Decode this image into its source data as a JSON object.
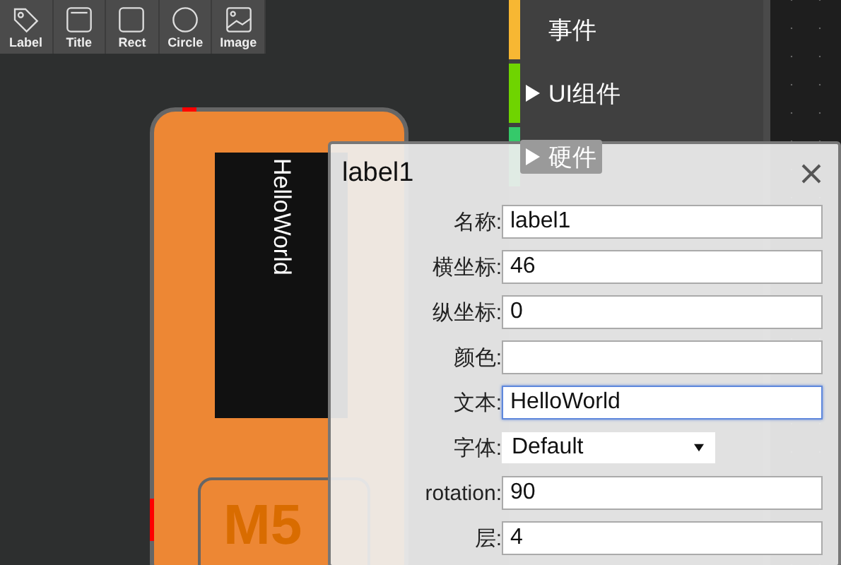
{
  "toolbar": [
    {
      "label": "Label",
      "kind": "tag"
    },
    {
      "label": "Title",
      "kind": "title"
    },
    {
      "label": "Rect",
      "kind": "rect"
    },
    {
      "label": "Circle",
      "kind": "circle"
    },
    {
      "label": "Image",
      "kind": "image"
    }
  ],
  "device": {
    "screen_text": "HelloWorld",
    "logo": "M5"
  },
  "categories": [
    {
      "label": "事件",
      "color": "#f7b733",
      "expandable": false
    },
    {
      "label": "UI组件",
      "color": "#6fd400",
      "expandable": true
    },
    {
      "label": "硬件",
      "color": "#35c96a",
      "expandable": true
    }
  ],
  "dialog": {
    "title": "label1",
    "fields": [
      {
        "label": "名称:",
        "kind": "text",
        "value": "label1",
        "focused": false
      },
      {
        "label": "横坐标:",
        "kind": "text",
        "value": "46",
        "focused": false
      },
      {
        "label": "纵坐标:",
        "kind": "text",
        "value": "0",
        "focused": false
      },
      {
        "label": "颜色:",
        "kind": "text",
        "focused": false
      },
      {
        "label": "文本:",
        "kind": "text",
        "value": "HelloWorld",
        "focused": true
      },
      {
        "label": "字体:",
        "kind": "select",
        "value": "Default",
        "focused": false
      },
      {
        "label": "rotation:",
        "kind": "text",
        "value": "90",
        "focused": false
      },
      {
        "label": "层:",
        "kind": "text",
        "value": "4",
        "focused": false
      }
    ]
  }
}
